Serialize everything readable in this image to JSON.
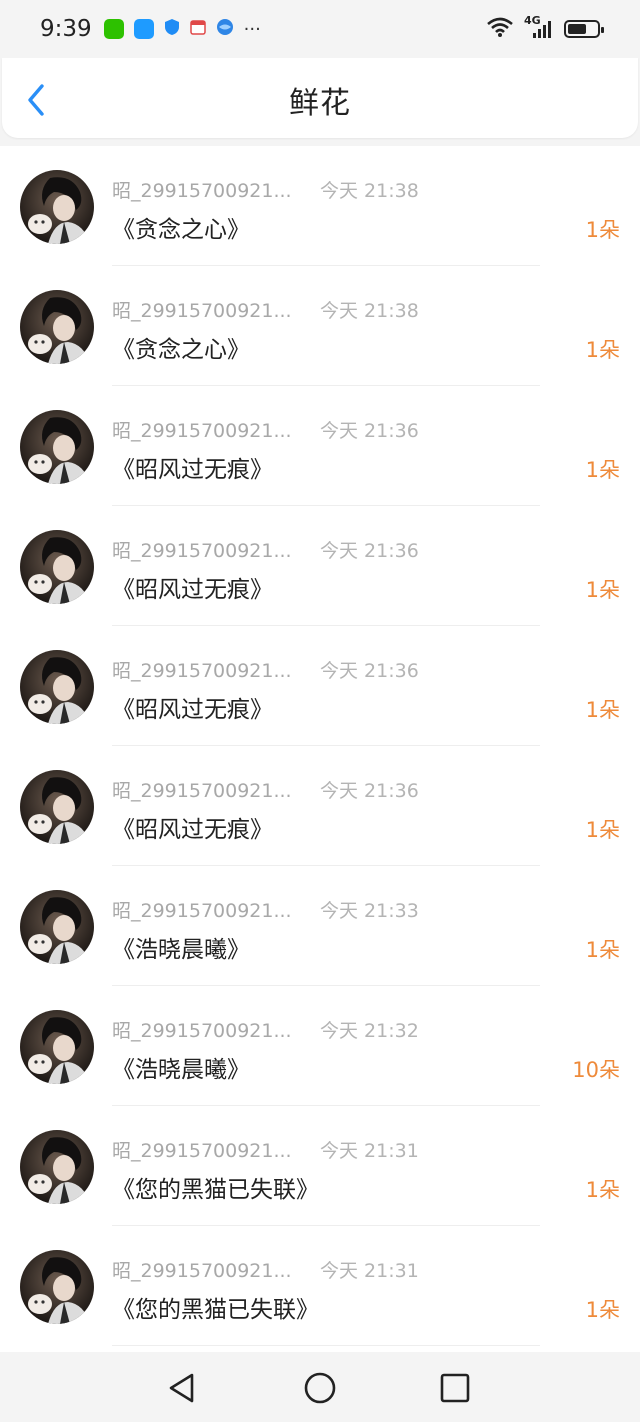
{
  "status_bar": {
    "time": "9:39",
    "app_icons": [
      "wechat-icon",
      "message-icon",
      "shield-icon",
      "calendar-icon",
      "browser-icon"
    ],
    "more": "···",
    "network": "4G"
  },
  "header": {
    "title": "鲜花"
  },
  "colors": {
    "accent_blue": "#2a8ff7",
    "count_orange": "#ee8a3a",
    "secondary_text": "#a8a8a8"
  },
  "list": {
    "items": [
      {
        "user": "昭_29915700921...",
        "time": "今天 21:38",
        "title": "《贪念之心》",
        "count": "1朵"
      },
      {
        "user": "昭_29915700921...",
        "time": "今天 21:38",
        "title": "《贪念之心》",
        "count": "1朵"
      },
      {
        "user": "昭_29915700921...",
        "time": "今天 21:36",
        "title": "《昭风过无痕》",
        "count": "1朵"
      },
      {
        "user": "昭_29915700921...",
        "time": "今天 21:36",
        "title": "《昭风过无痕》",
        "count": "1朵"
      },
      {
        "user": "昭_29915700921...",
        "time": "今天 21:36",
        "title": "《昭风过无痕》",
        "count": "1朵"
      },
      {
        "user": "昭_29915700921...",
        "time": "今天 21:36",
        "title": "《昭风过无痕》",
        "count": "1朵"
      },
      {
        "user": "昭_29915700921...",
        "time": "今天 21:33",
        "title": "《浩晓晨曦》",
        "count": "1朵"
      },
      {
        "user": "昭_29915700921...",
        "time": "今天 21:32",
        "title": "《浩晓晨曦》",
        "count": "10朵"
      },
      {
        "user": "昭_29915700921...",
        "time": "今天 21:31",
        "title": "《您的黑猫已失联》",
        "count": "1朵"
      },
      {
        "user": "昭_29915700921...",
        "time": "今天 21:31",
        "title": "《您的黑猫已失联》",
        "count": "1朵"
      }
    ]
  }
}
